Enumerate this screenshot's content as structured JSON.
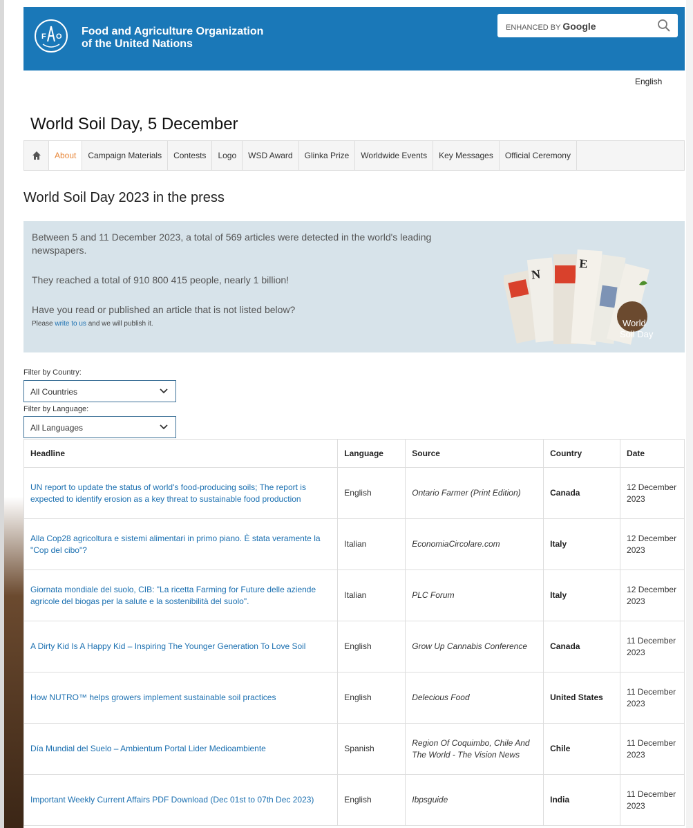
{
  "org": {
    "name_line1": "Food and Agriculture Organization",
    "name_line2": "of the United Nations"
  },
  "search": {
    "label_prefix": "ENHANCED BY",
    "label_brand": "Google"
  },
  "language": "English",
  "site_title": "World Soil Day, 5 December",
  "nav": {
    "items": [
      {
        "label": "About"
      },
      {
        "label": "Campaign Materials"
      },
      {
        "label": "Contests"
      },
      {
        "label": "Logo"
      },
      {
        "label": "WSD Award"
      },
      {
        "label": "Glinka Prize"
      },
      {
        "label": "Worldwide Events"
      },
      {
        "label": "Key Messages"
      },
      {
        "label": "Official Ceremony"
      }
    ]
  },
  "section_title": "World Soil Day 2023 in the press",
  "banner": {
    "line1": "Between 5 and 11 December 2023, a total of 569 articles were detected in the world's leading newspapers.",
    "line2": "They reached a total of 910 800 415 people, nearly 1 billion!",
    "line3": "Have you read or published an article that is not listed below?",
    "line4_prefix": "Please ",
    "line4_link": "write to us",
    "line4_suffix": " and we will publish it.",
    "image_text_1": "World",
    "image_text_2": "Soil Day"
  },
  "filters": {
    "country_label": "Filter by Country:",
    "country_value": "All Countries",
    "language_label": "Filter by Language:",
    "language_value": "All Languages"
  },
  "table": {
    "headers": [
      "Headline",
      "Language",
      "Source",
      "Country",
      "Date"
    ],
    "rows": [
      {
        "headline": "UN report to update the status of world's food-producing soils; The report is expected to identify erosion as a key threat to sustainable food production",
        "language": "English",
        "source": "Ontario Farmer (Print Edition)",
        "country": "Canada",
        "date": "12 December 2023"
      },
      {
        "headline": "Alla Cop28 agricoltura e sistemi alimentari in primo piano. È stata veramente la \"Cop del cibo\"?",
        "language": "Italian",
        "source": "EconomiaCircolare.com",
        "country": "Italy",
        "date": "12 December 2023"
      },
      {
        "headline": "Giornata mondiale del suolo, CIB: \"La ricetta Farming for Future delle aziende agricole del biogas per la salute e la sostenibilità del suolo\".",
        "language": "Italian",
        "source": "PLC Forum",
        "country": "Italy",
        "date": "12 December 2023"
      },
      {
        "headline": "A Dirty Kid Is A Happy Kid – Inspiring The Younger Generation To Love Soil",
        "language": "English",
        "source": "Grow Up Cannabis Conference",
        "country": "Canada",
        "date": "11 December 2023"
      },
      {
        "headline": "How NUTRO™ helps growers implement sustainable soil practices",
        "language": "English",
        "source": "Delecious Food",
        "country": "United States",
        "date": "11 December 2023"
      },
      {
        "headline": "Día Mundial del Suelo – Ambientum Portal Lider Medioambiente",
        "language": "Spanish",
        "source": "Region Of Coquimbo, Chile And The World - The Vision News",
        "country": "Chile",
        "date": "11 December 2023"
      },
      {
        "headline": "Important Weekly Current Affairs PDF Download (Dec 01st to 07th Dec 2023)",
        "language": "English",
        "source": "Ibpsguide",
        "country": "India",
        "date": "11 December 2023"
      }
    ]
  },
  "colors": {
    "header_bg": "#1a78b8",
    "banner_bg": "#d7e3ea",
    "link": "#1a6fb0",
    "nav_active": "#e8873a"
  }
}
